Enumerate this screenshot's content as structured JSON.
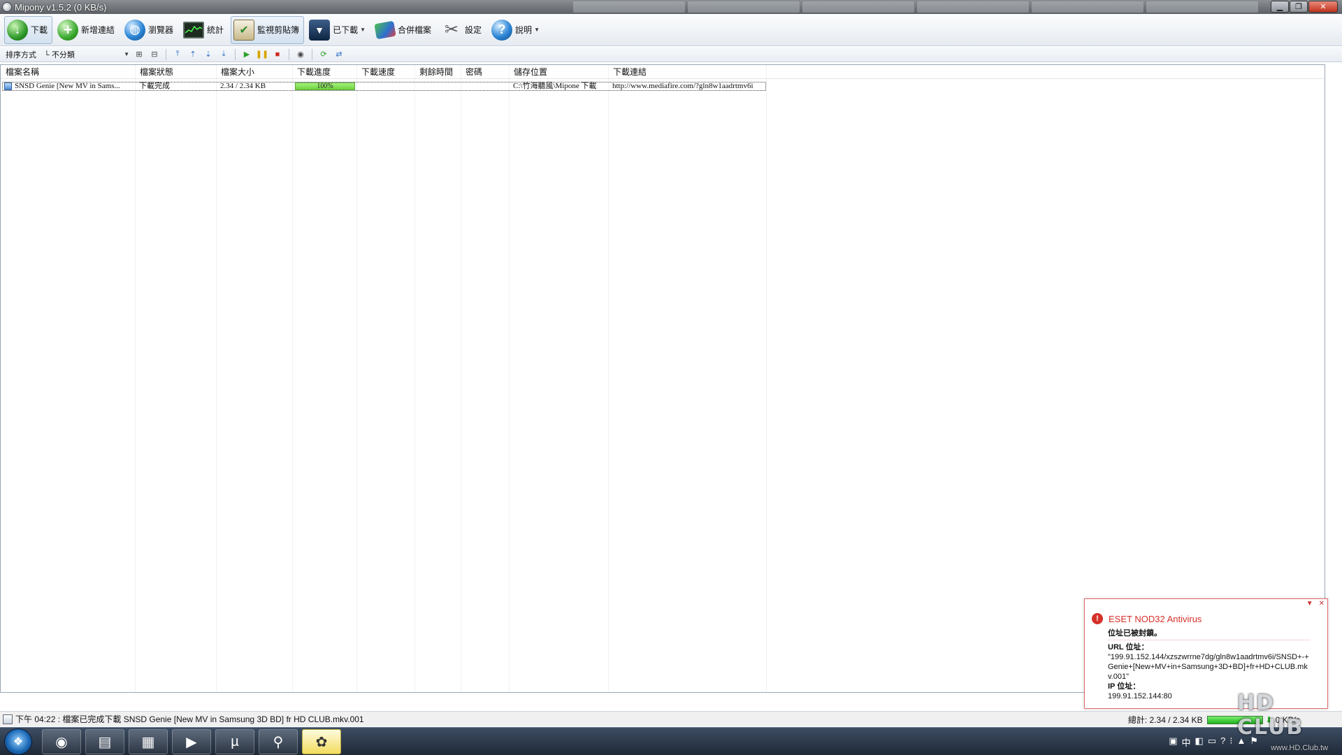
{
  "window": {
    "title": "Mipony v1.5.2 (0 KB/s)"
  },
  "toolbar": {
    "download": "下載",
    "add_link": "新增連結",
    "browser": "瀏覽器",
    "stats": "統計",
    "monitor_clipboard": "監視剪貼簿",
    "downloaded": "已下載",
    "merge_files": "合併檔案",
    "settings": "設定",
    "help": "說明"
  },
  "subbar": {
    "sort_label": "排序方式",
    "sort_value": "不分類"
  },
  "grid": {
    "columns": [
      "檔案名稱",
      "檔案狀態",
      "檔案大小",
      "下載進度",
      "下載速度",
      "剩餘時間",
      "密碼",
      "儲存位置",
      "下載連結"
    ],
    "rows": [
      {
        "name": "SNSD   Genie [New MV in Sams...",
        "status": "下載完成",
        "size": "2.34 / 2.34 KB",
        "progress_text": "100%",
        "progress_value": 1.0,
        "speed": "",
        "remaining": "",
        "password": "",
        "location": "C:\\竹海聽風\\Mipone 下載",
        "link": "http://www.mediafire.com/?gln8w1aadrtmv6i"
      }
    ]
  },
  "status": {
    "message": "下午 04:22 : 檔案已完成下載 SNSD   Genie [New MV in Samsung 3D BD] fr HD CLUB.mkv.001",
    "total": "總計: 2.34 / 2.34 KB",
    "speed": "0 KB/s"
  },
  "popup": {
    "app": "ESET NOD32 Antivirus",
    "blocked": "位址已被封鎖。",
    "url_label": "URL 位址：",
    "url_value": "\"199.91.152.144/xzszwrrne7dg/gln8w1aadrtmv6i/SNSD+-+Genie+[New+MV+in+Samsung+3D+BD]+fr+HD+CLUB.mkv.001\"",
    "ip_label": "IP 位址：",
    "ip_value": "199.91.152.144:80"
  },
  "taskbar": {
    "ime": "中"
  },
  "watermark": {
    "logo": "HD CLUB",
    "site": "www.HD.Club.tw"
  },
  "icons": [
    "app-icon",
    "download-icon",
    "add-icon",
    "globe-icon",
    "stats-icon",
    "clipboard-icon",
    "downloaded-icon",
    "merge-icon",
    "settings-icon",
    "help-icon",
    "start-icon",
    "chrome-icon",
    "explorer-icon",
    "folder-icon",
    "media-icon",
    "utorrent-icon",
    "mipony-icon",
    "alert-icon"
  ],
  "colors": {
    "progress": "#6dd33d",
    "popup_accent": "#d6302a",
    "taskbar": "#1f2937"
  }
}
